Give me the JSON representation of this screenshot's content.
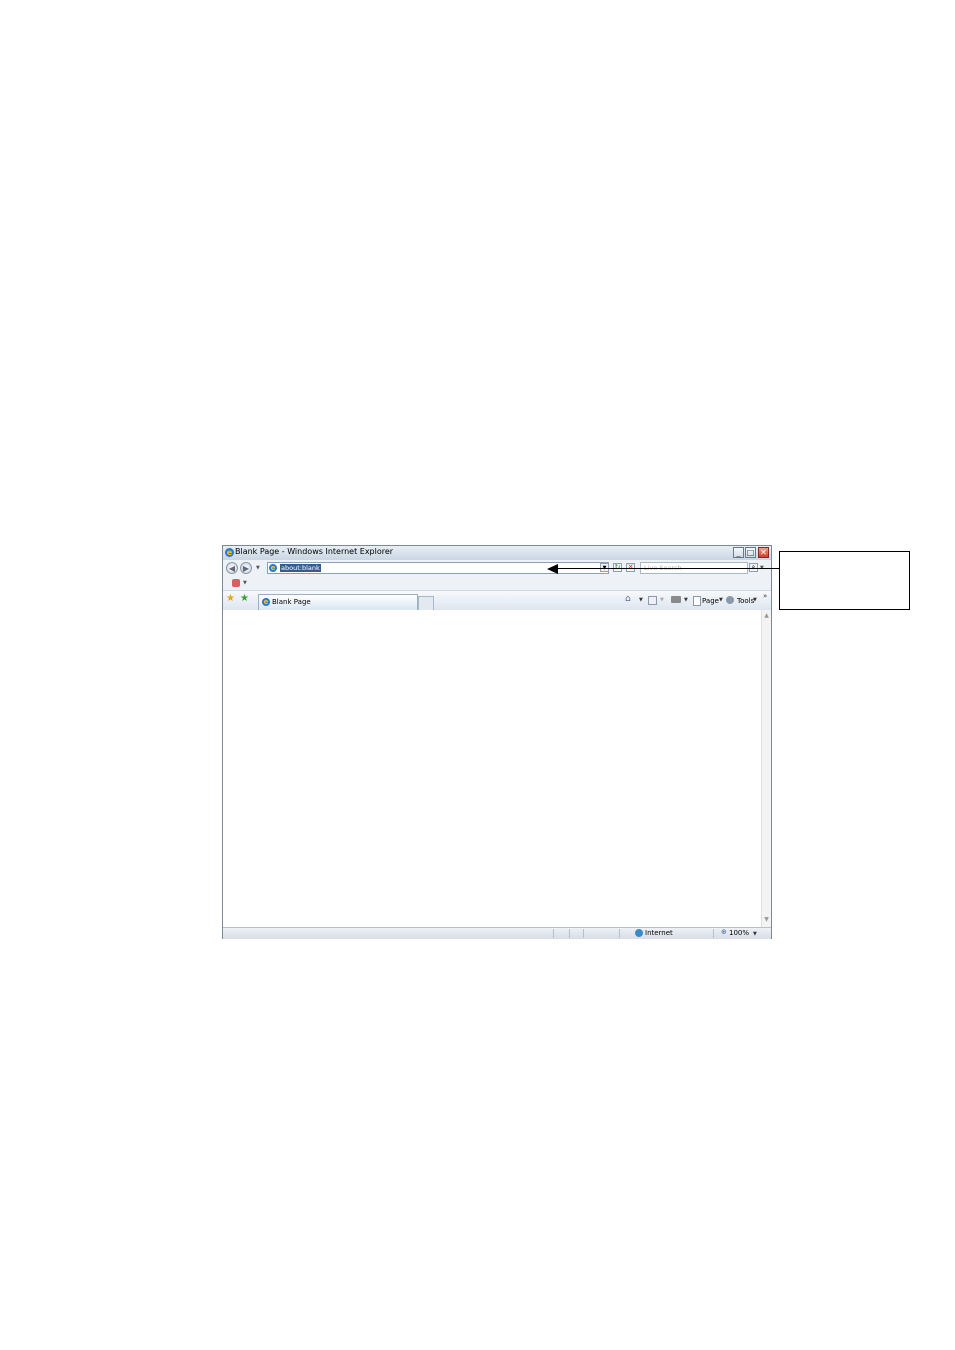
{
  "window": {
    "title": "Blank Page - Windows Internet Explorer",
    "minimize_glyph": "_",
    "maximize_glyph": "□",
    "close_glyph": "✕"
  },
  "nav": {
    "back_icon": "back-arrow-icon",
    "forward_icon": "forward-arrow-icon",
    "address": "about:blank",
    "search_placeholder": "Live Search"
  },
  "tabs": [
    {
      "label": "Blank Page",
      "active": true
    }
  ],
  "toolbar": {
    "page_label": "Page",
    "tools_label": "Tools",
    "overflow": "»"
  },
  "status": {
    "zone": "Internet",
    "zoom": "100%"
  },
  "colors": {
    "ie_blue": "#2a78c8",
    "close_red": "#c8402a",
    "address_selection": "#3a5a8a"
  }
}
